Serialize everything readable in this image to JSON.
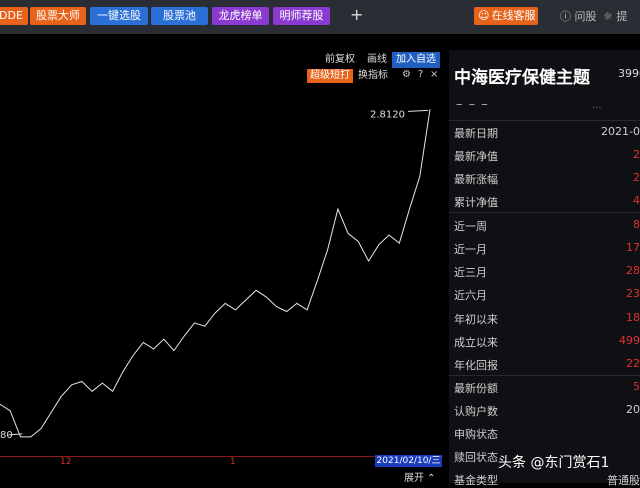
{
  "toolbar": {
    "tabs": [
      {
        "label": "DDE",
        "color": "#e8631a"
      },
      {
        "label": "股票大师",
        "color": "#e8631a"
      },
      {
        "label": "一键选股",
        "color": "#2a6fd6"
      },
      {
        "label": "股票池",
        "color": "#2a6fd6"
      },
      {
        "label": "龙虎榜单",
        "color": "#8a3ad0"
      },
      {
        "label": "明师荐股",
        "color": "#8a3ad0"
      }
    ],
    "plus": "+",
    "service": "在线客服",
    "ask": "问股",
    "ask2": "提"
  },
  "chart_controls": {
    "restore": "前复权",
    "draw": "画线",
    "add_favorite": "加入自选",
    "super_short": "超级短打",
    "swap_indicator": "换指标",
    "gear": "⚙",
    "help": "?",
    "close": "×"
  },
  "chart_data": {
    "type": "line",
    "max_label": "2.8120",
    "min_label": "80",
    "x_ticks": [
      "12",
      "1"
    ],
    "current_date": "2021/02/10/三",
    "ylim": [
      0.75,
      2.9
    ],
    "series": [
      {
        "values": [
          1.0,
          0.96,
          0.8,
          0.8,
          0.85,
          0.95,
          1.05,
          1.12,
          1.14,
          1.08,
          1.13,
          1.08,
          1.2,
          1.3,
          1.38,
          1.34,
          1.4,
          1.33,
          1.42,
          1.5,
          1.48,
          1.56,
          1.62,
          1.58,
          1.64,
          1.7,
          1.66,
          1.6,
          1.57,
          1.62,
          1.58,
          1.76,
          1.95,
          2.2,
          2.05,
          2.0,
          1.88,
          1.98,
          2.04,
          1.99,
          2.2,
          2.4,
          2.812
        ]
      }
    ]
  },
  "chart_footer": {
    "expand": "展开"
  },
  "fund": {
    "name": "中海医疗保健主题",
    "code": "3990",
    "dashes": "– – –",
    "dots": "..."
  },
  "stats": [
    {
      "label": "最新日期",
      "value": "2021-0",
      "red": false
    },
    {
      "label": "最新净值",
      "value": "2",
      "red": true
    },
    {
      "label": "最新涨幅",
      "value": "2",
      "red": true
    },
    {
      "label": "累计净值",
      "value": "4",
      "red": true
    },
    {
      "label": "近一周",
      "value": "8",
      "red": true
    },
    {
      "label": "近一月",
      "value": "17",
      "red": true
    },
    {
      "label": "近三月",
      "value": "28",
      "red": true
    },
    {
      "label": "近六月",
      "value": "23",
      "red": true
    },
    {
      "label": "年初以来",
      "value": "18",
      "red": true
    },
    {
      "label": "成立以来",
      "value": "499",
      "red": true
    },
    {
      "label": "年化回报",
      "value": "22",
      "red": true
    },
    {
      "label": "最新份额",
      "value": "5",
      "red": true
    },
    {
      "label": "认购户数",
      "value": "20",
      "red": false
    },
    {
      "label": "申购状态",
      "value": "",
      "red": false
    },
    {
      "label": "赎回状态",
      "value": "",
      "red": false
    },
    {
      "label": "基金类型",
      "value": "普通股",
      "red": false
    }
  ],
  "watermark": "头条 @东门赏石1"
}
